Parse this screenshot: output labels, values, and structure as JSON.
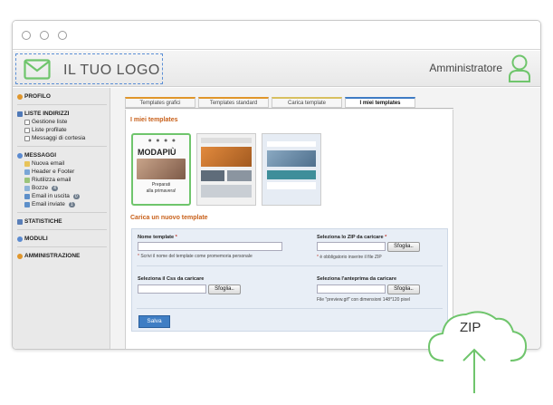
{
  "header": {
    "logo_text": "IL TUO LOGO",
    "user_name": "Amministratore"
  },
  "sidebar": {
    "sections": [
      {
        "label": "PROFILO",
        "items": []
      },
      {
        "label": "LISTE INDIRIZZI",
        "items": [
          {
            "label": "Gestione liste"
          },
          {
            "label": "Liste profilate"
          },
          {
            "label": "Messaggi di cortesia"
          }
        ]
      },
      {
        "label": "MESSAGGI",
        "items": [
          {
            "label": "Nuova email"
          },
          {
            "label": "Header e Footer"
          },
          {
            "label": "Riutilizza email"
          },
          {
            "label": "Bozze",
            "badge": "4"
          },
          {
            "label": "Email in uscita",
            "badge": "0"
          },
          {
            "label": "Email inviate",
            "badge": "1"
          }
        ]
      },
      {
        "label": "STATISTICHE",
        "items": []
      },
      {
        "label": "MODULI",
        "items": []
      },
      {
        "label": "AMMINISTRAZIONE",
        "items": []
      }
    ]
  },
  "tabs": [
    "Templates grafici",
    "Templates standard",
    "Carica template",
    "I miei templates"
  ],
  "active_tab": "I miei templates",
  "my_templates_title": "I miei templates",
  "thumb1": {
    "brand": "MODAPIÙ",
    "caption_line1": "Preparati",
    "caption_line2": "alla primavera!"
  },
  "upload": {
    "title": "Carica un nuovo template",
    "name_label": "Nome template",
    "name_note": "Scrivi il nome del template come promemoria personale",
    "zip_label": "Seleziona lo ZIP da caricare",
    "zip_note": "è obbligatorio inserire il file ZIP",
    "css_label": "Seleziona il Css da caricare",
    "preview_label": "Seleziona l'anteprima da caricare",
    "preview_note": "File \"preview.gif\" con dimensioni 148*120 pixel",
    "browse_label": "Sfoglia..",
    "required_mark": "*",
    "save_label": "Salva"
  },
  "cloud": {
    "label": "ZIP"
  },
  "colors": {
    "accent": "#6fc56c",
    "title_orange": "#c8601a",
    "tab_active_blue": "#3e7bc4",
    "save_blue": "#3f7ec4"
  }
}
